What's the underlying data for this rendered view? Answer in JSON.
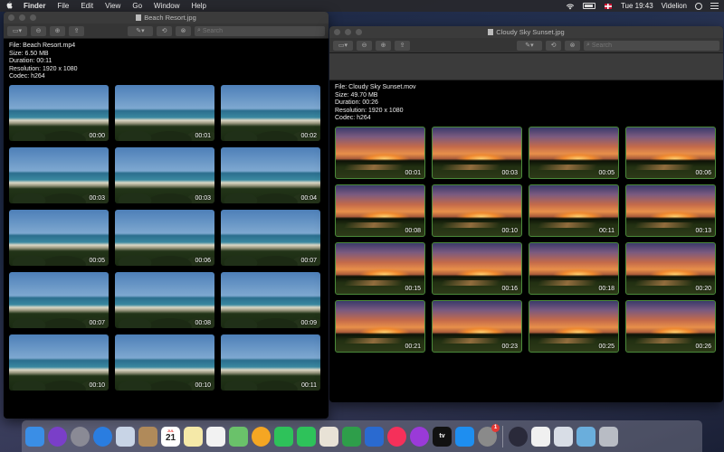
{
  "menubar": {
    "app": "Finder",
    "items": [
      "File",
      "Edit",
      "View",
      "Go",
      "Window",
      "Help"
    ],
    "clock": "Tue 19:43",
    "user": "Videlion"
  },
  "window1": {
    "title": "Beach Resort.jpg",
    "search_placeholder": "Search",
    "info": {
      "file": "File: Beach Resort.mp4",
      "size": "Size: 6.50 MB",
      "duration": "Duration: 00:11",
      "resolution": "Resolution: 1920 x 1080",
      "codec": "Codec: h264"
    },
    "thumbnails": [
      "00:00",
      "00:01",
      "00:02",
      "00:03",
      "00:03",
      "00:04",
      "00:05",
      "00:06",
      "00:07",
      "00:07",
      "00:08",
      "00:09",
      "00:10",
      "00:10",
      "00:11"
    ]
  },
  "window2": {
    "title": "Cloudy Sky Sunset.jpg",
    "search_placeholder": "Search",
    "info": {
      "file": "File: Cloudy Sky Sunset.mov",
      "size": "Size: 49.70 MB",
      "duration": "Duration: 00:26",
      "resolution": "Resolution: 1920 x 1080",
      "codec": "Codec: h264"
    },
    "thumbnails": [
      "00:01",
      "00:03",
      "00:05",
      "00:06",
      "00:08",
      "00:10",
      "00:11",
      "00:13",
      "00:15",
      "00:16",
      "00:18",
      "00:20",
      "00:21",
      "00:23",
      "00:25",
      "00:26"
    ]
  },
  "dock": {
    "calendar_month": "JUL",
    "calendar_day": "21",
    "tv_label": "tv",
    "sysprefs_badge": "1",
    "items": [
      {
        "name": "finder-icon",
        "color": "#3a8ee6"
      },
      {
        "name": "siri-icon",
        "color": "#7a3fc8"
      },
      {
        "name": "launchpad-icon",
        "color": "#8a8a95"
      },
      {
        "name": "safari-icon",
        "color": "#2a7de0"
      },
      {
        "name": "mail-stamp-icon",
        "color": "#c8d4e6"
      },
      {
        "name": "contacts-icon",
        "color": "#b08a5a"
      },
      {
        "name": "calendar-icon",
        "color": "#ffffff"
      },
      {
        "name": "notes-icon",
        "color": "#f5e9a8"
      },
      {
        "name": "reminders-icon",
        "color": "#f2f2f2"
      },
      {
        "name": "maps-icon",
        "color": "#6ac26a"
      },
      {
        "name": "photos-icon",
        "color": "#f5a623"
      },
      {
        "name": "messages-icon",
        "color": "#2ec25a"
      },
      {
        "name": "facetime-icon",
        "color": "#2ec25a"
      },
      {
        "name": "keynote-doc-icon",
        "color": "#e8e2d6"
      },
      {
        "name": "numbers-icon",
        "color": "#2e9e4a"
      },
      {
        "name": "keynote-icon",
        "color": "#2a6ad0"
      },
      {
        "name": "music-icon",
        "color": "#f5305a"
      },
      {
        "name": "podcasts-icon",
        "color": "#9a3ad8"
      },
      {
        "name": "tv-icon",
        "color": "#111111"
      },
      {
        "name": "app-store-icon",
        "color": "#1e8ef0"
      },
      {
        "name": "system-preferences-icon",
        "color": "#8a8a8a"
      },
      {
        "name": "quicktime-icon",
        "color": "#2a2a3a"
      },
      {
        "name": "textedit-icon",
        "color": "#f0f0f0"
      },
      {
        "name": "preview-icon",
        "color": "#d8dde6"
      },
      {
        "name": "downloads-folder-icon",
        "color": "#6aaedc"
      },
      {
        "name": "trash-icon",
        "color": "#b8bcc4"
      }
    ]
  }
}
